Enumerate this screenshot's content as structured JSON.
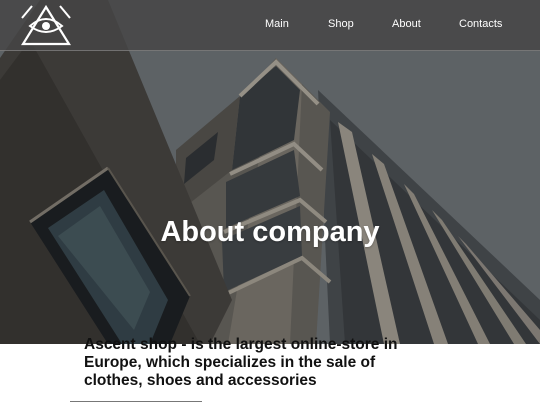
{
  "nav": {
    "logo": "triangle-eye-logo",
    "items": [
      {
        "label": "Main"
      },
      {
        "label": "Shop"
      },
      {
        "label": "About"
      },
      {
        "label": "Contacts"
      }
    ]
  },
  "hero": {
    "title": "About company",
    "background": "modern-building-photo"
  },
  "intro": {
    "text": "Ascent shop - is the largest online-store in Europe, which specializes in the sale of clothes, shoes and accessories"
  },
  "colors": {
    "navbar": "#464646",
    "hero_text": "#ffffff",
    "body_text": "#111111"
  }
}
